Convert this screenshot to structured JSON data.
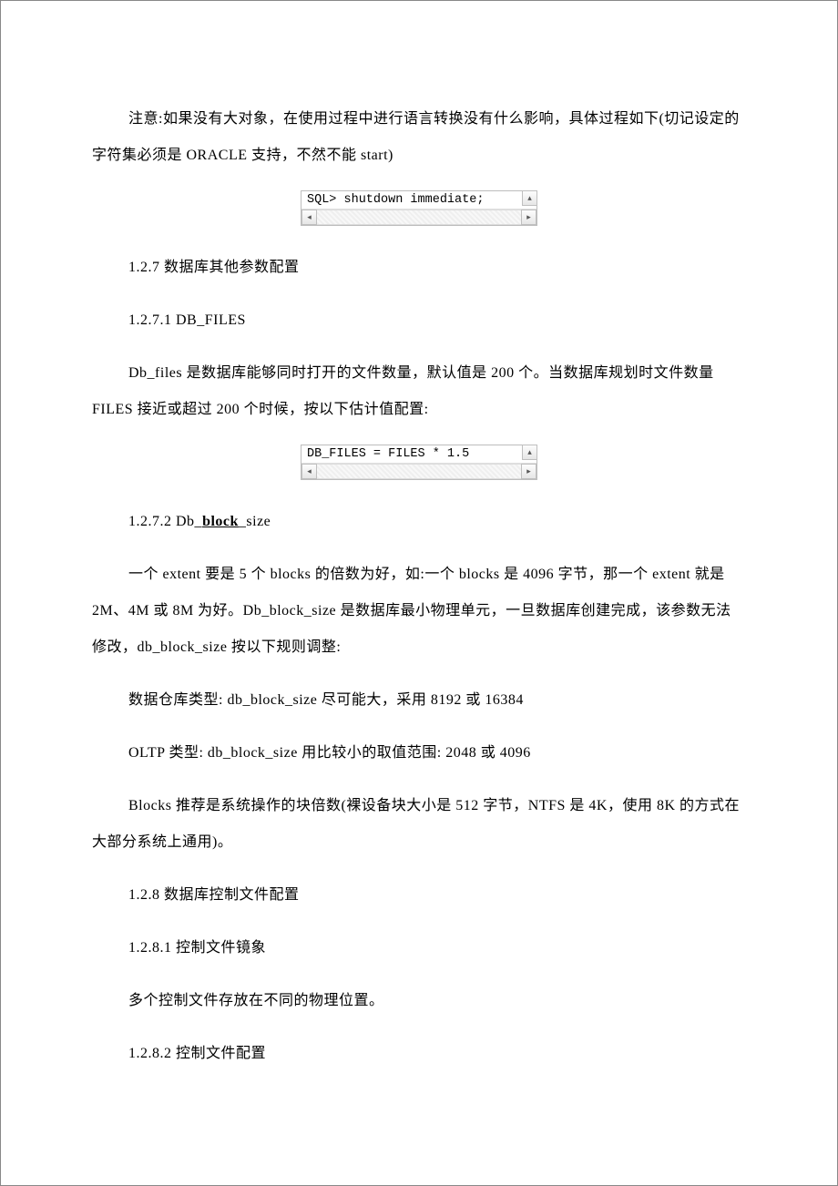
{
  "paragraphs": {
    "p1": "注意:如果没有大对象，在使用过程中进行语言转换没有什么影响，具体过程如下(切记设定的字符集必须是 ORACLE 支持，不然不能 start)",
    "code1": "SQL> shutdown immediate;",
    "h127": "1.2.7 数据库其他参数配置",
    "h1271": "1.2.7.1 DB_FILES",
    "p2": "Db_files 是数据库能够同时打开的文件数量，默认值是 200 个。当数据库规划时文件数量 FILES 接近或超过 200 个时候，按以下估计值配置:",
    "code2": "DB_FILES = FILES * 1.5",
    "h1272_prefix": "1.2.7.2 Db_",
    "h1272_bold": "block",
    "h1272_suffix": "_size",
    "p3": "一个 extent 要是 5 个 blocks 的倍数为好，如:一个 blocks 是 4096 字节，那一个 extent 就是 2M、4M 或 8M 为好。Db_block_size 是数据库最小物理单元，一旦数据库创建完成，该参数无法修改，db_block_size 按以下规则调整:",
    "p4": "数据仓库类型: db_block_size 尽可能大，采用 8192 或 16384",
    "p5": "OLTP 类型: db_block_size 用比较小的取值范围: 2048 或 4096",
    "p6": "Blocks 推荐是系统操作的块倍数(裸设备块大小是 512 字节，NTFS 是 4K，使用 8K 的方式在大部分系统上通用)。",
    "h128": "1.2.8 数据库控制文件配置",
    "h1281": "1.2.8.1 控制文件镜象",
    "p7": "多个控制文件存放在不同的物理位置。",
    "h1282": "1.2.8.2 控制文件配置"
  },
  "arrows": {
    "left": "◂",
    "right": "▸",
    "up": "▴"
  }
}
